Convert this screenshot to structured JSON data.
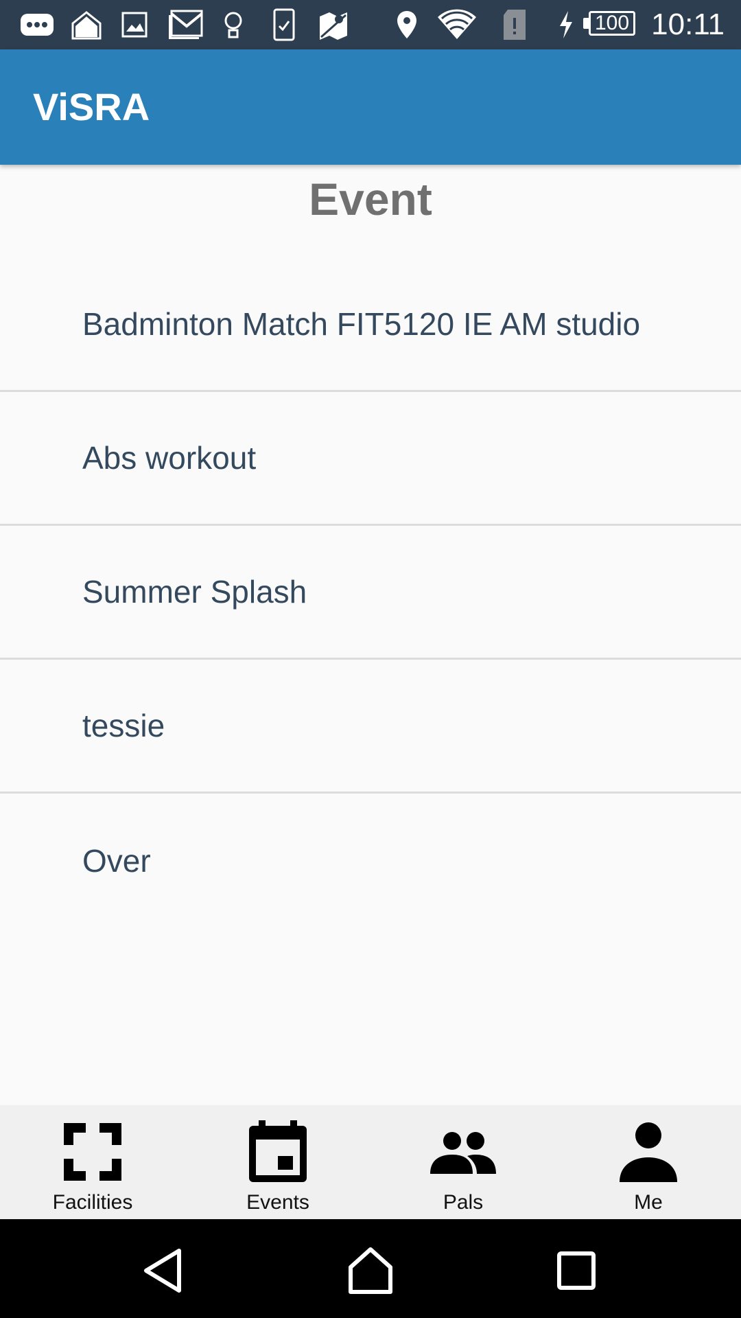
{
  "status_bar": {
    "time": "10:11",
    "battery": "100",
    "icons": [
      "messages-icon",
      "photos-icon",
      "image-icon",
      "gmail-icon",
      "lightbulb-icon",
      "clipboard-icon",
      "maps-icon",
      "location-icon",
      "wifi-icon",
      "sim-alert-icon",
      "charging-icon"
    ]
  },
  "app_bar": {
    "title": "ViSRA",
    "color": "#2a80b9"
  },
  "page": {
    "title": "Event"
  },
  "events": [
    "Badminton Match FIT5120 IE AM studio",
    "Abs workout",
    "Summer Splash",
    "tessie",
    "Over"
  ],
  "tabs": [
    {
      "label": "Facilities",
      "icon": "fullscreen-icon"
    },
    {
      "label": "Events",
      "icon": "calendar-icon"
    },
    {
      "label": "Pals",
      "icon": "people-icon"
    },
    {
      "label": "Me",
      "icon": "person-icon"
    }
  ],
  "nav": [
    "back-icon",
    "home-icon",
    "recents-icon"
  ]
}
